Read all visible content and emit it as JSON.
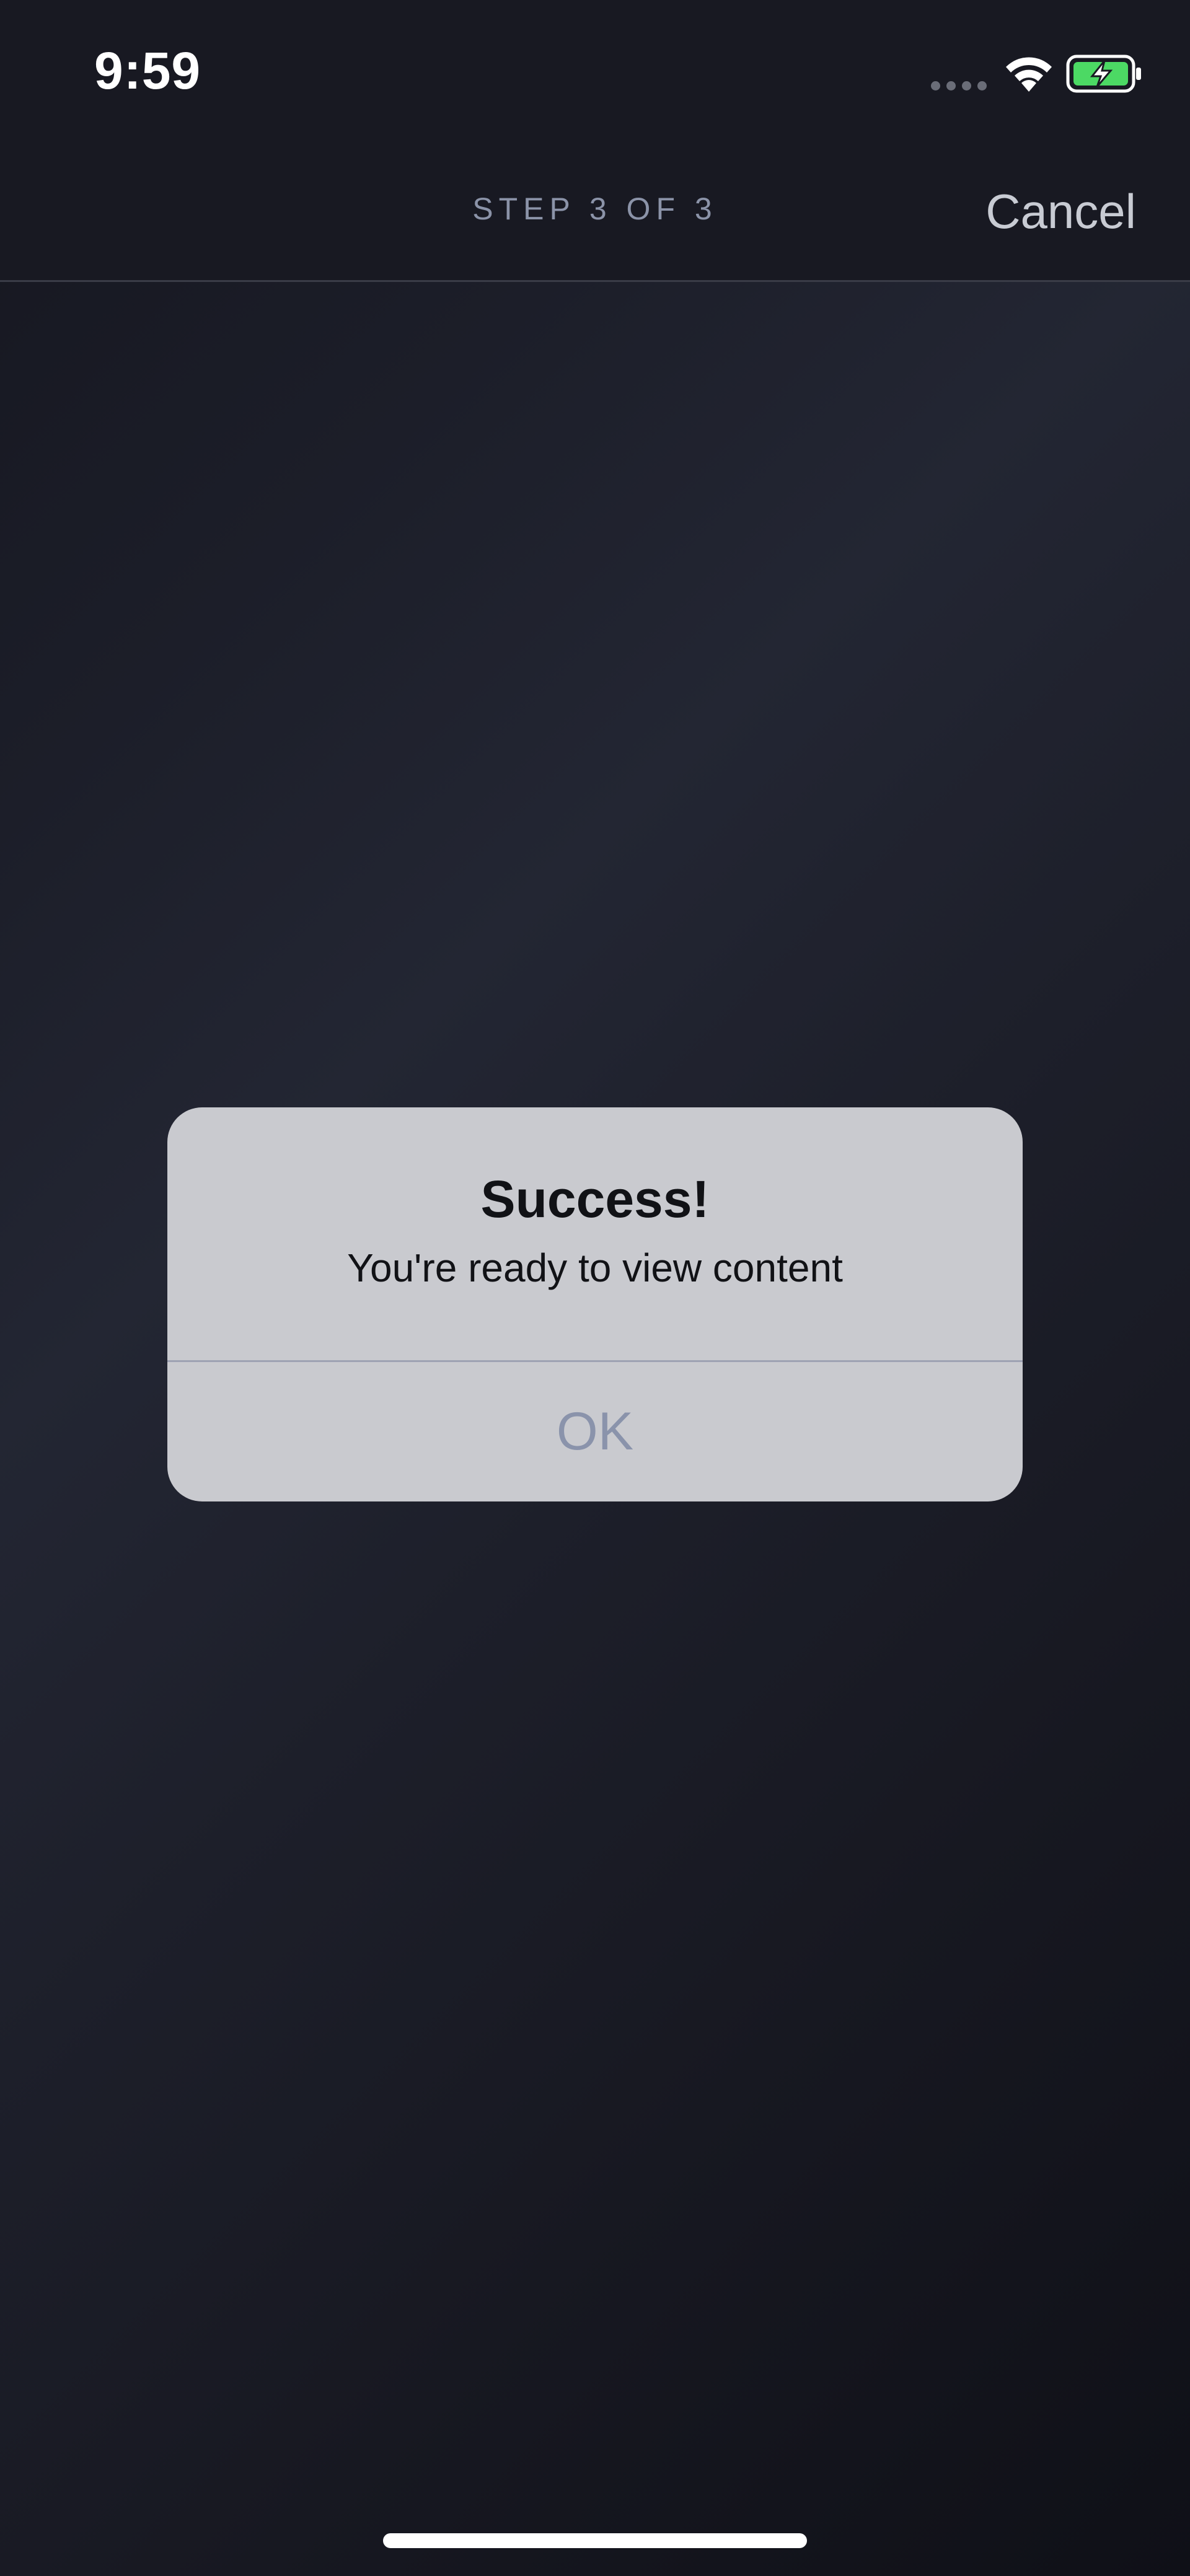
{
  "status_bar": {
    "time": "9:59",
    "icons": [
      "cellular-signal-icon",
      "wifi-icon",
      "battery-charging-icon"
    ],
    "battery_color": "#4cd964"
  },
  "nav": {
    "step_label": "STEP 3 OF 3",
    "cancel_label": "Cancel"
  },
  "alert": {
    "title": "Success!",
    "message": "You're ready to view content",
    "ok_label": "OK"
  },
  "colors": {
    "background": "#1c1e29",
    "alert_background": "#c9cacf",
    "ok_text": "#8a93ab"
  }
}
